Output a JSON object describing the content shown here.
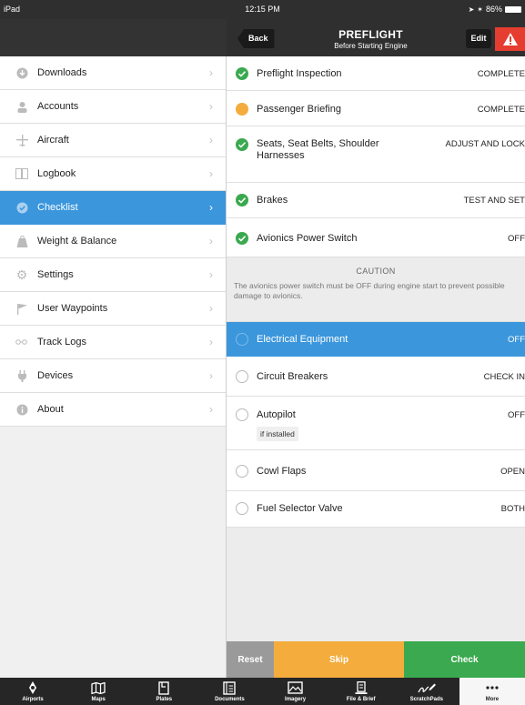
{
  "status_bar": {
    "device": "iPad",
    "time": "12:15 PM",
    "battery": "86%"
  },
  "nav": {
    "back_label": "Back",
    "title": "PREFLIGHT",
    "subtitle": "Before Starting Engine",
    "edit_label": "Edit"
  },
  "sidebar": {
    "items": [
      {
        "label": "Downloads",
        "icon": "download-icon"
      },
      {
        "label": "Accounts",
        "icon": "person-icon"
      },
      {
        "label": "Aircraft",
        "icon": "airplane-icon"
      },
      {
        "label": "Logbook",
        "icon": "book-icon"
      },
      {
        "label": "Checklist",
        "icon": "check-circle-icon",
        "active": true
      },
      {
        "label": "Weight & Balance",
        "icon": "weight-icon"
      },
      {
        "label": "Settings",
        "icon": "gear-icon"
      },
      {
        "label": "User Waypoints",
        "icon": "flag-icon"
      },
      {
        "label": "Track Logs",
        "icon": "track-icon"
      },
      {
        "label": "Devices",
        "icon": "plug-icon"
      },
      {
        "label": "About",
        "icon": "info-icon"
      }
    ]
  },
  "checklist": {
    "items": [
      {
        "title": "Preflight Inspection",
        "value": "COMPLETE",
        "state": "done"
      },
      {
        "title": "Passenger Briefing",
        "value": "COMPLETE",
        "state": "pending"
      },
      {
        "title": "Seats, Seat Belts, Shoulder Harnesses",
        "value": "ADJUST AND LOCK",
        "state": "done"
      },
      {
        "title": "Brakes",
        "value": "TEST AND SET",
        "state": "done"
      },
      {
        "title": "Avionics Power Switch",
        "value": "OFF",
        "state": "done"
      },
      {
        "title": "Electrical Equipment",
        "value": "OFF",
        "state": "active"
      },
      {
        "title": "Circuit Breakers",
        "value": "CHECK IN",
        "state": "open"
      },
      {
        "title": "Autopilot",
        "value": "OFF",
        "note": "if installed",
        "state": "open"
      },
      {
        "title": "Cowl Flaps",
        "value": "OPEN",
        "state": "open"
      },
      {
        "title": "Fuel Selector Valve",
        "value": "BOTH",
        "state": "open"
      }
    ],
    "caution": {
      "heading": "CAUTION",
      "text": "The avionics power switch must be OFF during engine start to prevent possible damage to avionics."
    }
  },
  "actions": {
    "reset": "Reset",
    "skip": "Skip",
    "check": "Check"
  },
  "tabs": [
    {
      "label": "Airports",
      "icon": "airport-icon"
    },
    {
      "label": "Maps",
      "icon": "map-icon"
    },
    {
      "label": "Plates",
      "icon": "plates-icon"
    },
    {
      "label": "Documents",
      "icon": "documents-icon"
    },
    {
      "label": "Imagery",
      "icon": "imagery-icon"
    },
    {
      "label": "File & Brief",
      "icon": "file-brief-icon"
    },
    {
      "label": "ScratchPads",
      "icon": "scratchpad-icon"
    },
    {
      "label": "More",
      "icon": "more-icon",
      "active": true
    }
  ],
  "colors": {
    "accent": "#3b96dc",
    "done": "#3aa94f",
    "pending": "#f4ac3d",
    "alert": "#e53d2f",
    "bar": "#2f2f2f"
  }
}
